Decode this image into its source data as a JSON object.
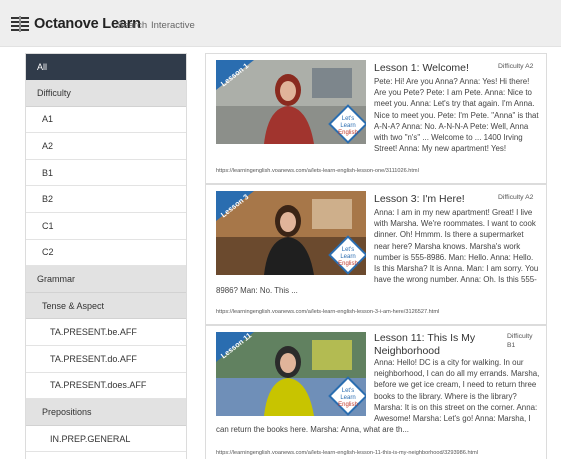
{
  "navbar": {
    "brand": "Octanove Learn",
    "links": [
      "Search",
      "Interactive"
    ]
  },
  "sidebar": {
    "items": [
      {
        "label": "All",
        "kind": "active",
        "level": 0
      },
      {
        "label": "Difficulty",
        "kind": "group",
        "level": 0
      },
      {
        "label": "A1",
        "kind": "item",
        "level": 1
      },
      {
        "label": "A2",
        "kind": "item",
        "level": 1
      },
      {
        "label": "B1",
        "kind": "item",
        "level": 1
      },
      {
        "label": "B2",
        "kind": "item",
        "level": 1
      },
      {
        "label": "C1",
        "kind": "item",
        "level": 1
      },
      {
        "label": "C2",
        "kind": "item",
        "level": 1
      },
      {
        "label": "Grammar",
        "kind": "group",
        "level": 0
      },
      {
        "label": "Tense & Aspect",
        "kind": "group",
        "level": 1
      },
      {
        "label": "TA.PRESENT.be.AFF",
        "kind": "item",
        "level": 2
      },
      {
        "label": "TA.PRESENT.do.AFF",
        "kind": "item",
        "level": 2
      },
      {
        "label": "TA.PRESENT.does.AFF",
        "kind": "item",
        "level": 2
      },
      {
        "label": "Prepositions",
        "kind": "group",
        "level": 1
      },
      {
        "label": "IN.PREP.GENERAL",
        "kind": "item",
        "level": 2
      }
    ]
  },
  "lessons": [
    {
      "title": "Lesson 1: Welcome!",
      "difficulty": "Difficulty A2",
      "badge": "Lesson 1",
      "logo": [
        "Let's",
        "Learn",
        "English"
      ],
      "text": "Pete: Hi! Are you Anna? Anna: Yes! Hi there! Are you Pete? Pete: I am Pete. Anna: Nice to meet you. Anna: Let's try that again. I'm Anna. Nice to meet you. Pete: I'm Pete. \"Anna\" is that A-N-A? Anna: No. A-N-N-A Pete: Well, Anna with two \"n's\" ... Welcome to ... 1400 Irving Street! Anna: My new apartment! Yes!",
      "url": "https://learningenglish.voanews.com/a/lets-learn-english-lesson-one/3111026.html",
      "colors": {
        "bg": "#8c8f8a",
        "wall": "#b9bcb6",
        "figure": "#a1342e",
        "hair": "#8a2a1f",
        "accent": "#5e6a7a"
      }
    },
    {
      "title": "Lesson 3: I'm Here!",
      "difficulty": "Difficulty A2",
      "badge": "Lesson 3",
      "logo": [
        "Let's",
        "Learn",
        "English"
      ],
      "text": "Anna: I am in my new apartment! Great! I live with Marsha. We're roommates. I want to cook dinner. Oh! Hmmm. Is there a supermarket near here? Marsha knows. Marsha's work number is 555-8986. Man: Hello. Anna: Hello. Is this Marsha? It is Anna. Man: I am sorry. You have the wrong number. Anna: Oh. Is this 555-8986? Man: No. This ...",
      "url": "https://learningenglish.voanews.com/a/lets-learn-english-lesson-3-i-am-here/3126527.html",
      "colors": {
        "bg": "#6b4a2e",
        "wall": "#c08a55",
        "figure": "#1f1f1f",
        "hair": "#3a2416",
        "accent": "#e7d6b8"
      }
    },
    {
      "title": "Lesson 11: This Is My Neighborhood",
      "difficulty": "Difficulty B1",
      "badge": "Lesson 11",
      "logo": [
        "Let's",
        "Learn",
        "English"
      ],
      "text": "Anna: Hello! DC is a city for walking. In our neighborhood, I can do all my errands. Marsha, before we get ice cream, I need to return three books to the library. Where is the library? Marsha: It is on this street on the corner. Anna: Awesome! Marsha: Let's go! Anna: Marsha, I can return the books here. Marsha: Anna, what are th...",
      "url": "https://learningenglish.voanews.com/a/lets-learn-english-lesson-11-this-is-my-neighborhood/3293986.html",
      "colors": {
        "bg": "#6f8fb8",
        "wall": "#5b7a3a",
        "figure": "#c8c400",
        "hair": "#2b2b2b",
        "accent": "#e9e24a"
      }
    }
  ]
}
